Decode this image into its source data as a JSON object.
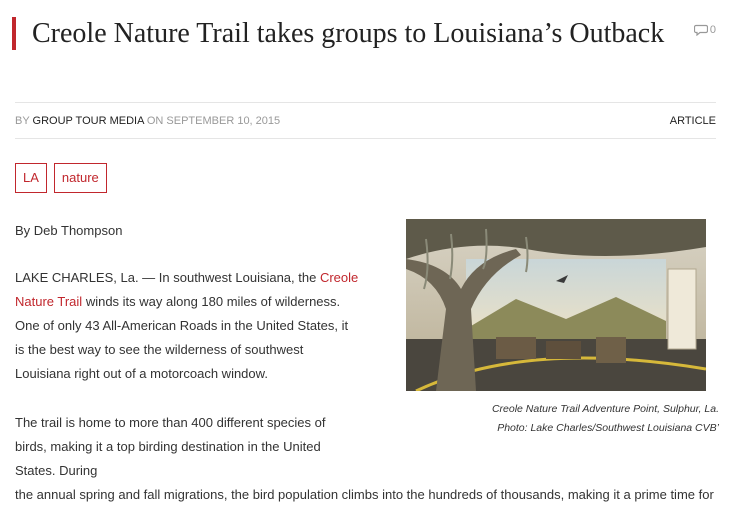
{
  "article": {
    "title": "Creole Nature Trail takes groups to Louisiana’s Outback",
    "comments_count": "0",
    "meta": {
      "by_label": "BY",
      "author": "GROUP TOUR MEDIA",
      "on_label": "ON",
      "date": "SEPTEMBER 10, 2015",
      "category": "ARTICLE"
    },
    "tags": [
      "LA",
      "nature"
    ],
    "byline": "By Deb Thompson",
    "paragraph1": {
      "before_link": "LAKE CHARLES, La. — In southwest Louisiana, the ",
      "link": "Creole Nature Trail",
      "after_link": " winds its way along 180 miles of wilderness. One of only 43 All-American Roads in the United States, it is the best way to see the wilderness of southwest Louisiana right out of a motorcoach window."
    },
    "paragraph2": {
      "narrow": "The trail is home to more than 400 different species of birds, making it a top birding destination in the United States. During",
      "wide": "the annual spring and fall migrations, the bird population climbs into the hundreds of thousands, making it a prime time for visiting groups."
    },
    "image": {
      "caption_line1": "Creole Nature Trail Adventure Point, Sulphur, La.",
      "caption_line2": "Photo: Lake Charles/Southwest Louisiana CVB’"
    }
  },
  "icons": {
    "comments": "speech-bubble-icon"
  },
  "colors": {
    "accent": "#c1272d",
    "muted": "#999999",
    "text": "#333333"
  }
}
